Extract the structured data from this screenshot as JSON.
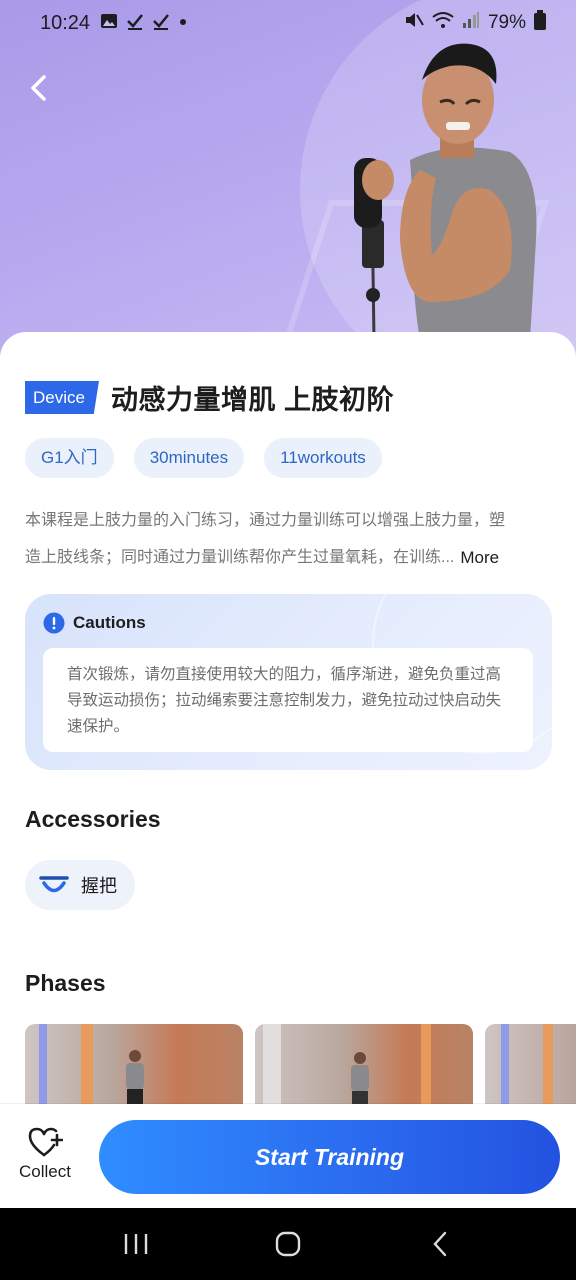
{
  "status_bar": {
    "time": "10:24",
    "battery": "79%",
    "left_icons": [
      "image-icon",
      "check-icon",
      "check-icon",
      "dot-icon"
    ],
    "right_icons": [
      "mute-icon",
      "wifi-icon",
      "signal-icon",
      "battery-icon"
    ]
  },
  "header": {
    "back_icon": "chevron-left-icon"
  },
  "course": {
    "tag": "Device",
    "title": "动感力量增肌 上肢初阶",
    "chips": [
      "G1入门",
      "30minutes",
      "11workouts"
    ],
    "description_line1": "本课程是上肢力量的入门练习，通过力量训练可以增强上肢力量，塑",
    "description_line2": "造上肢线条；同时通过力量训练帮你产生过量氧耗，在训练...",
    "more_label": "More"
  },
  "cautions": {
    "title": "Cautions",
    "icon": "exclamation-icon",
    "text": "首次锻炼，请勿直接使用较大的阻力，循序渐进，避免负重过高导致运动损伤；拉动绳索要注意控制发力，避免拉动过快启动失速保护。"
  },
  "accessories": {
    "title": "Accessories",
    "items": [
      {
        "label": "握把",
        "icon": "handle-grip-icon"
      }
    ]
  },
  "phases": {
    "title": "Phases",
    "count_visible": 3
  },
  "bottom": {
    "collect_label": "Collect",
    "collect_icon": "heart-plus-icon",
    "start_label": "Start Training"
  },
  "colors": {
    "accent": "#2d68e8",
    "hero_bg": "#b6a8ef",
    "chip_bg": "#eaf1fb",
    "chip_text": "#2f66c6"
  }
}
